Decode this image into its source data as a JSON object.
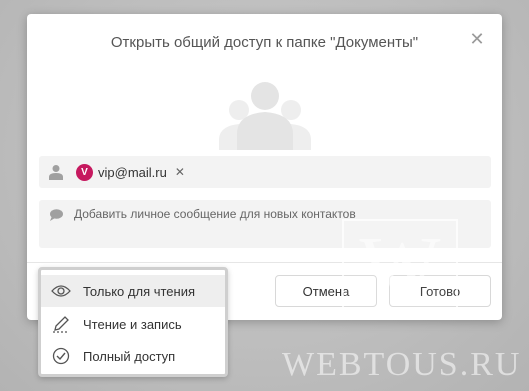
{
  "dialog": {
    "title": "Открыть общий доступ к папке \"Документы\"",
    "close_icon": "close-icon"
  },
  "recipients": {
    "icon": "person-icon",
    "chips": [
      {
        "avatar_letter": "V",
        "email": "vip@mail.ru",
        "avatar_color": "#c6195f"
      }
    ]
  },
  "message": {
    "icon": "speech-bubble-icon",
    "placeholder": "Добавить личное сообщение для новых контактов"
  },
  "buttons": {
    "cancel_label": "Отмена",
    "done_label": "Готово"
  },
  "access_menu": {
    "items": [
      {
        "label": "Только для чтения",
        "icon": "eye-icon",
        "selected": true
      },
      {
        "label": "Чтение и запись",
        "icon": "pencil-icon",
        "selected": false
      },
      {
        "label": "Полный доступ",
        "icon": "check-circle-icon",
        "selected": false
      }
    ]
  },
  "watermark": {
    "letter": "W",
    "text": "WEBTOUS.RU"
  }
}
